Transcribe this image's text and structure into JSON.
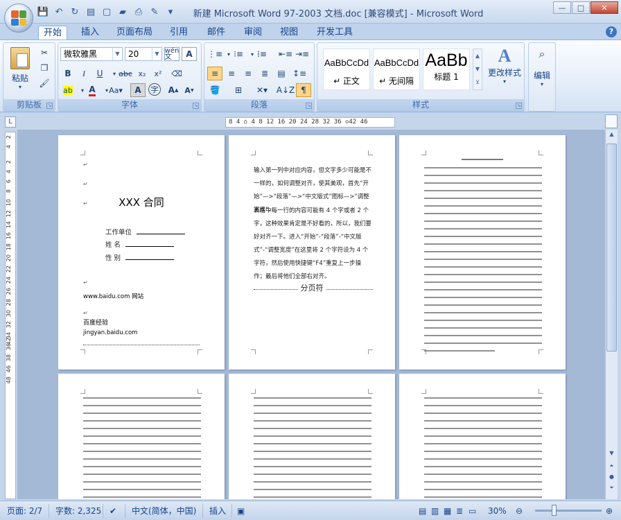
{
  "window": {
    "title": "新建 Microsoft Word 97-2003 文档.doc [兼容模式] - Microsoft Word",
    "controls": [
      "—",
      "□",
      "✕"
    ]
  },
  "tabs": [
    "开始",
    "插入",
    "页面布局",
    "引用",
    "邮件",
    "审阅",
    "视图",
    "开发工具"
  ],
  "ribbon": {
    "clipboard": {
      "paste": "粘贴",
      "label": "剪贴板"
    },
    "font": {
      "name": "微软雅黑",
      "size": "20",
      "label": "字体",
      "wen_btn": "wén\n文"
    },
    "paragraph": {
      "label": "段落"
    },
    "styles": {
      "label": "样式",
      "items": [
        {
          "sample": "AaBbCcDd",
          "name": "↵ 正文"
        },
        {
          "sample": "AaBbCcDd",
          "name": "↵ 无间隔"
        },
        {
          "sample": "AaBb",
          "name": "标题 1"
        }
      ],
      "change_style": "更改样式"
    },
    "editing": {
      "label": "编辑"
    }
  },
  "ruler": {
    "horizontal": "8  4  ⌂  4  8  12 16 20 24 28 32 36 ◇42 46",
    "vertical": [
      "2",
      "4",
      "2",
      "4",
      "6",
      "8",
      "10",
      "12",
      "14",
      "16",
      "18",
      "20",
      "22",
      "24",
      "26",
      "28",
      "30",
      "32",
      "34",
      "36",
      "38",
      "40",
      "42",
      "44",
      "46",
      "48"
    ]
  },
  "page1": {
    "title": "XXX 合同",
    "fields": [
      {
        "label": "工作单位",
        "value": ""
      },
      {
        "label": "姓    名",
        "value": ""
      },
      {
        "label": "性    别",
        "value": ""
      }
    ],
    "website": "www.baidu.com 网站",
    "company": "百度经验",
    "company_url": "jingyan.baidu.com"
  },
  "page2": {
    "paragraphs": [
      "输入第一列中对应内容，但文字多少可能是不一样的，如何调整对齐，使其美观，首先“开始”—>“段落”—>“中文版式”图标—>“调整宽度”。",
      "表格中每一行的内容可能有 4 个字或者 2 个字，这种效果肯定是不好看的，所以，我们要好对齐一下。进入“开始”-“段落”-“中文版式”-“调整宽度”在这里将 2 个字符设为 4 个字符，然后使用快捷键“F4”重复上一步操作；最后将他们全部右对齐。"
    ],
    "page_break": "分页符"
  },
  "status": {
    "page": "页面: 2/7",
    "words": "字数: 2,325",
    "language": "中文(简体，中国)",
    "mode": "插入",
    "zoom": "30%"
  }
}
